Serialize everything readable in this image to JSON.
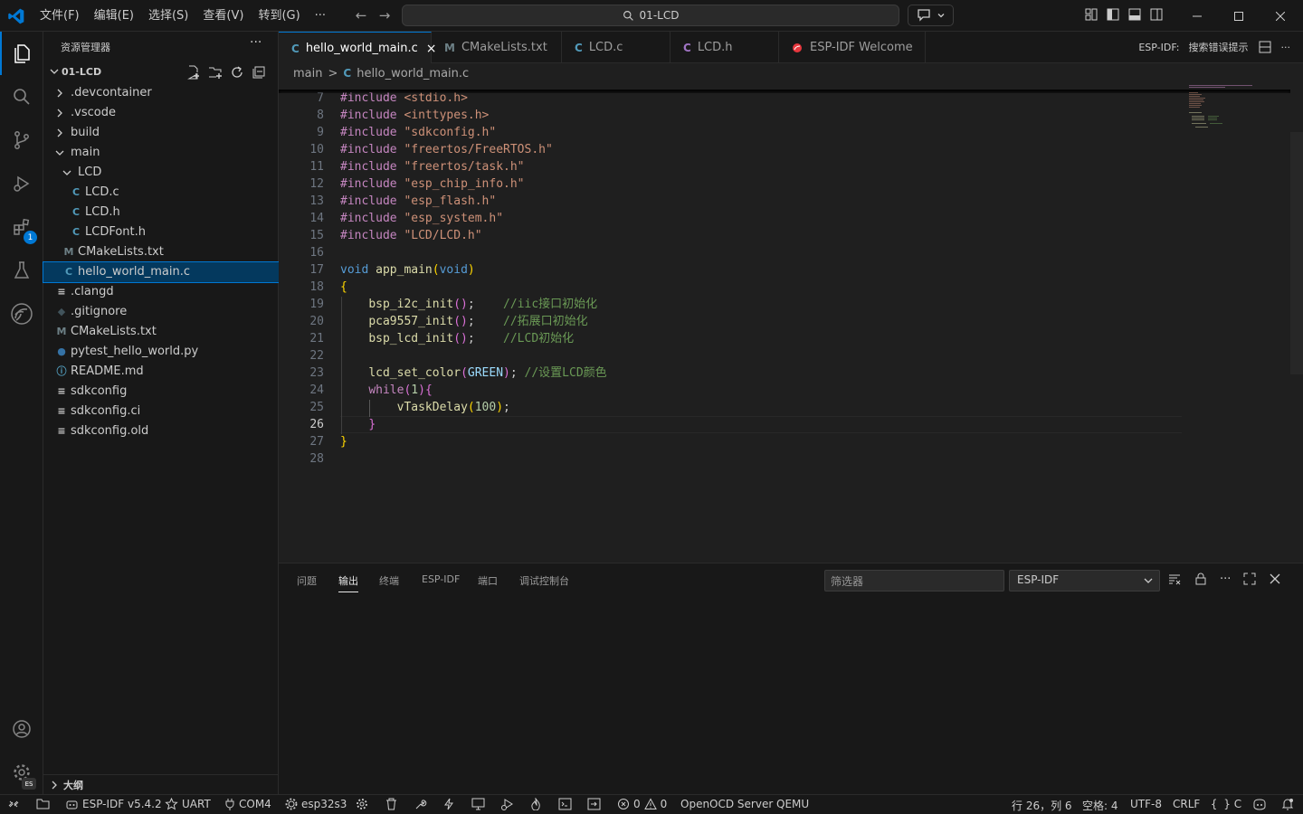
{
  "menu": [
    "文件(F)",
    "编辑(E)",
    "选择(S)",
    "查看(V)",
    "转到(G)",
    "···"
  ],
  "command_center": "01-LCD",
  "sidebar": {
    "title": "资源管理器",
    "more": "···",
    "folder": "01-LCD",
    "tree": [
      {
        "label": ".devcontainer",
        "type": "folder",
        "open": false,
        "depth": 0
      },
      {
        "label": ".vscode",
        "type": "folder",
        "open": false,
        "depth": 0
      },
      {
        "label": "build",
        "type": "folder",
        "open": false,
        "depth": 0
      },
      {
        "label": "main",
        "type": "folder",
        "open": true,
        "depth": 0
      },
      {
        "label": "LCD",
        "type": "folder",
        "open": true,
        "depth": 1
      },
      {
        "label": "LCD.c",
        "type": "c",
        "depth": 2
      },
      {
        "label": "LCD.h",
        "type": "c",
        "depth": 2
      },
      {
        "label": "LCDFont.h",
        "type": "c",
        "depth": 2
      },
      {
        "label": "CMakeLists.txt",
        "type": "cmake",
        "depth": 1
      },
      {
        "label": "hello_world_main.c",
        "type": "c",
        "depth": 1,
        "selected": true
      },
      {
        "label": ".clangd",
        "type": "lines",
        "depth": 0
      },
      {
        "label": ".gitignore",
        "type": "git",
        "depth": 0
      },
      {
        "label": "CMakeLists.txt",
        "type": "cmake",
        "depth": 0
      },
      {
        "label": "pytest_hello_world.py",
        "type": "py",
        "depth": 0
      },
      {
        "label": "README.md",
        "type": "info",
        "depth": 0
      },
      {
        "label": "sdkconfig",
        "type": "lines",
        "depth": 0
      },
      {
        "label": "sdkconfig.ci",
        "type": "lines",
        "depth": 0
      },
      {
        "label": "sdkconfig.old",
        "type": "lines",
        "depth": 0
      }
    ],
    "outline": "大纲"
  },
  "activity_badge": "1",
  "activity_badge_es": "ES",
  "tabs": [
    {
      "label": "hello_world_main.c",
      "icon": "C",
      "active": true,
      "close": "×"
    },
    {
      "label": "CMakeLists.txt",
      "icon": "M"
    },
    {
      "label": "LCD.c",
      "icon": "C"
    },
    {
      "label": "LCD.h",
      "icon": "C"
    },
    {
      "label": "ESP-IDF Welcome",
      "icon": "esp"
    }
  ],
  "tab_actions": {
    "esp_label": "ESP-IDF:",
    "hint": "搜索错误提示",
    "more": "···"
  },
  "breadcrumb": {
    "folder": "main",
    "sep": ">",
    "file": "hello_world_main.c",
    "icon": "C"
  },
  "code": {
    "current_line": 26,
    "lines": [
      {
        "n": 7,
        "t": [
          [
            "kw",
            "#include "
          ],
          [
            "str",
            "<stdio.h>"
          ]
        ]
      },
      {
        "n": 8,
        "t": [
          [
            "kw",
            "#include "
          ],
          [
            "str",
            "<inttypes.h>"
          ]
        ]
      },
      {
        "n": 9,
        "t": [
          [
            "kw",
            "#include "
          ],
          [
            "str",
            "\"sdkconfig.h\""
          ]
        ]
      },
      {
        "n": 10,
        "t": [
          [
            "kw",
            "#include "
          ],
          [
            "str",
            "\"freertos/FreeRTOS.h\""
          ]
        ]
      },
      {
        "n": 11,
        "t": [
          [
            "kw",
            "#include "
          ],
          [
            "str",
            "\"freertos/task.h\""
          ]
        ]
      },
      {
        "n": 12,
        "t": [
          [
            "kw",
            "#include "
          ],
          [
            "str",
            "\"esp_chip_info.h\""
          ]
        ]
      },
      {
        "n": 13,
        "t": [
          [
            "kw",
            "#include "
          ],
          [
            "str",
            "\"esp_flash.h\""
          ]
        ]
      },
      {
        "n": 14,
        "t": [
          [
            "kw",
            "#include "
          ],
          [
            "str",
            "\"esp_system.h\""
          ]
        ]
      },
      {
        "n": 15,
        "t": [
          [
            "kw",
            "#include "
          ],
          [
            "str",
            "\"LCD/LCD.h\""
          ]
        ]
      },
      {
        "n": 16,
        "t": []
      },
      {
        "n": 17,
        "t": [
          [
            "ty",
            "void "
          ],
          [
            "fn",
            "app_main"
          ],
          [
            "br1",
            "("
          ],
          [
            "ty",
            "void"
          ],
          [
            "br1",
            ")"
          ]
        ]
      },
      {
        "n": 18,
        "t": [
          [
            "br1",
            "{"
          ]
        ]
      },
      {
        "n": 19,
        "t": [
          [
            "pl",
            "    "
          ],
          [
            "fn",
            "bsp_i2c_init"
          ],
          [
            "br2",
            "()"
          ],
          [
            "pl",
            ";    "
          ],
          [
            "cm",
            "//iic接口初始化"
          ]
        ]
      },
      {
        "n": 20,
        "t": [
          [
            "pl",
            "    "
          ],
          [
            "fn",
            "pca9557_init"
          ],
          [
            "br2",
            "()"
          ],
          [
            "pl",
            ";    "
          ],
          [
            "cm",
            "//拓展口初始化"
          ]
        ]
      },
      {
        "n": 21,
        "t": [
          [
            "pl",
            "    "
          ],
          [
            "fn",
            "bsp_lcd_init"
          ],
          [
            "br2",
            "()"
          ],
          [
            "pl",
            ";    "
          ],
          [
            "cm",
            "//LCD初始化"
          ]
        ]
      },
      {
        "n": 22,
        "t": []
      },
      {
        "n": 23,
        "t": [
          [
            "pl",
            "    "
          ],
          [
            "fn",
            "lcd_set_color"
          ],
          [
            "br2",
            "("
          ],
          [
            "mac",
            "GREEN"
          ],
          [
            "br2",
            ")"
          ],
          [
            "pl",
            "; "
          ],
          [
            "cm",
            "//设置LCD颜色"
          ]
        ]
      },
      {
        "n": 24,
        "t": [
          [
            "pl",
            "    "
          ],
          [
            "kw",
            "while"
          ],
          [
            "br2",
            "("
          ],
          [
            "num",
            "1"
          ],
          [
            "br2",
            ")"
          ],
          [
            "br2",
            "{"
          ]
        ]
      },
      {
        "n": 25,
        "t": [
          [
            "pl",
            "        "
          ],
          [
            "fn",
            "vTaskDelay"
          ],
          [
            "br1",
            "("
          ],
          [
            "num",
            "100"
          ],
          [
            "br1",
            ")"
          ],
          [
            "pl",
            ";"
          ]
        ]
      },
      {
        "n": 26,
        "t": [
          [
            "pl",
            "    "
          ],
          [
            "br2",
            "}"
          ]
        ]
      },
      {
        "n": 27,
        "t": [
          [
            "br1",
            "}"
          ]
        ]
      },
      {
        "n": 28,
        "t": []
      }
    ]
  },
  "panel": {
    "tabs": [
      "问题",
      "输出",
      "终端",
      "ESP-IDF",
      "端口",
      "调试控制台"
    ],
    "active_tab": 1,
    "filter_placeholder": "筛选器",
    "channel": "ESP-IDF"
  },
  "status": {
    "idf": "ESP-IDF v5.4.2",
    "uart": "UART",
    "com": "COM4",
    "chip": "esp32s3",
    "errors": "0",
    "warnings": "0",
    "openocd": "OpenOCD Server",
    "qemu": "QEMU",
    "position": "行 26，列 6",
    "spaces": "空格: 4",
    "encoding": "UTF-8",
    "eol": "CRLF",
    "language": "C"
  },
  "colors": {
    "accent": "#0078d4",
    "c_icon": "#519aba",
    "cmake_icon": "#6d8086",
    "esp_icon": "#e7373e"
  }
}
